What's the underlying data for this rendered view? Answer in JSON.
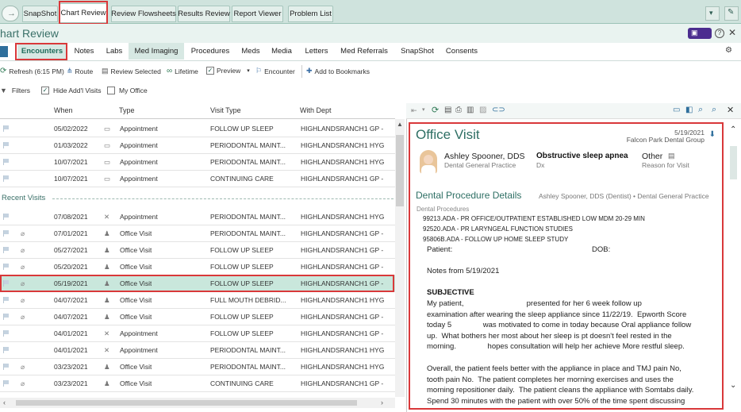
{
  "top_tabs": [
    "SnapShot",
    "Chart Review",
    "Review Flowsheets",
    "Results Review",
    "Report Viewer",
    "Problem List"
  ],
  "title": "hart Review",
  "sub_tabs": [
    "Encounters",
    "Notes",
    "Labs",
    "Med Imaging",
    "Procedures",
    "Meds",
    "Media",
    "Letters",
    "Med Referrals",
    "SnapShot",
    "Consents"
  ],
  "toolbar": {
    "refresh": "Refresh (6:15 PM)",
    "route": "Route",
    "review_selected": "Review Selected",
    "lifetime": "Lifetime",
    "preview": "Preview",
    "encounter": "Encounter",
    "bookmarks": "Add to Bookmarks"
  },
  "filters": {
    "filters": "Filters",
    "hide_addl": "Hide Add'l Visits",
    "my_office": "My Office"
  },
  "columns": [
    "When",
    "Type",
    "Visit Type",
    "With Dept"
  ],
  "upcoming_rows": [
    {
      "when": "05/02/2022",
      "type": "Appointment",
      "visit": "FOLLOW UP SLEEP",
      "dept": "HIGHLANDSRANCH1 GP -"
    },
    {
      "when": "01/03/2022",
      "type": "Appointment",
      "visit": "PERIODONTAL MAINT...",
      "dept": "HIGHLANDSRANCH1 HYG"
    },
    {
      "when": "10/07/2021",
      "type": "Appointment",
      "visit": "PERIODONTAL MAINT...",
      "dept": "HIGHLANDSRANCH1 HYG"
    },
    {
      "when": "10/07/2021",
      "type": "Appointment",
      "visit": "CONTINUING CARE",
      "dept": "HIGHLANDSRANCH1 GP -"
    }
  ],
  "section_label": "Recent Visits",
  "recent_rows": [
    {
      "when": "07/08/2021",
      "type": "Appointment",
      "visit": "PERIODONTAL MAINT...",
      "dept": "HIGHLANDSRANCH1 HYG"
    },
    {
      "when": "07/01/2021",
      "type": "Office Visit",
      "visit": "PERIODONTAL MAINT...",
      "dept": "HIGHLANDSRANCH1 GP -"
    },
    {
      "when": "05/27/2021",
      "type": "Office Visit",
      "visit": "FOLLOW UP SLEEP",
      "dept": "HIGHLANDSRANCH1 GP -"
    },
    {
      "when": "05/20/2021",
      "type": "Office Visit",
      "visit": "FOLLOW UP SLEEP",
      "dept": "HIGHLANDSRANCH1 GP -"
    },
    {
      "when": "05/19/2021",
      "type": "Office Visit",
      "visit": "FOLLOW UP SLEEP",
      "dept": "HIGHLANDSRANCH1 GP -"
    },
    {
      "when": "04/07/2021",
      "type": "Office Visit",
      "visit": "FULL MOUTH DEBRID...",
      "dept": "HIGHLANDSRANCH1 HYG"
    },
    {
      "when": "04/07/2021",
      "type": "Office Visit",
      "visit": "FOLLOW UP SLEEP",
      "dept": "HIGHLANDSRANCH1 GP -"
    },
    {
      "when": "04/01/2021",
      "type": "Appointment",
      "visit": "FOLLOW UP SLEEP",
      "dept": "HIGHLANDSRANCH1 GP -"
    },
    {
      "when": "04/01/2021",
      "type": "Appointment",
      "visit": "PERIODONTAL MAINT...",
      "dept": "HIGHLANDSRANCH1 HYG"
    },
    {
      "when": "03/23/2021",
      "type": "Office Visit",
      "visit": "PERIODONTAL MAINT...",
      "dept": "HIGHLANDSRANCH1 HYG"
    },
    {
      "when": "03/23/2021",
      "type": "Office Visit",
      "visit": "CONTINUING CARE",
      "dept": "HIGHLANDSRANCH1 GP -"
    }
  ],
  "doc": {
    "title": "Office Visit",
    "date": "5/19/2021",
    "location": "Falcon Park Dental Group",
    "provider": "Ashley Spooner, DDS",
    "provider_role": "Dental General Practice",
    "dx": "Obstructive sleep apnea",
    "dx_label": "Dx",
    "reason": "Other",
    "reason_label": "Reason for Visit",
    "section_title": "Dental Procedure Details",
    "section_sub": "Ashley Spooner, DDS (Dentist) • Dental General Practice",
    "procedures_label": "Dental Procedures",
    "procedures": [
      "99213.ADA - PR OFFICE/OUTPATIENT ESTABLISHED LOW MDM 20-29 MIN",
      "92520.ADA - PR LARYNGEAL FUNCTION STUDIES",
      "95806B.ADA - FOLLOW UP HOME SLEEP STUDY"
    ],
    "patient_label": "Patient:",
    "dob_label": "DOB:",
    "notes_from": "Notes from 5/19/2021",
    "subjective": "SUBJECTIVE",
    "para1": [
      "My patient,                              presented for her 6 week follow up",
      "examination after wearing the sleep appliance since 11/22/19.  Epworth Score",
      "today 5               was motivated to come in today because Oral appliance follow",
      "up.  What bothers her most about her sleep is pt doesn't feel rested in the",
      "morning.               hopes consultation will help her achieve More restful sleep."
    ],
    "para2": [
      "Overall, the patient feels better with the appliance in place and TMJ pain No,",
      "tooth pain No.  The patient completes her morning exercises and uses the",
      "morning repositioner daily.  The patient cleans the appliance with Somtabs daily.",
      "Spend 30 minutes with the patient with over 50% of the time spent discussing"
    ]
  }
}
